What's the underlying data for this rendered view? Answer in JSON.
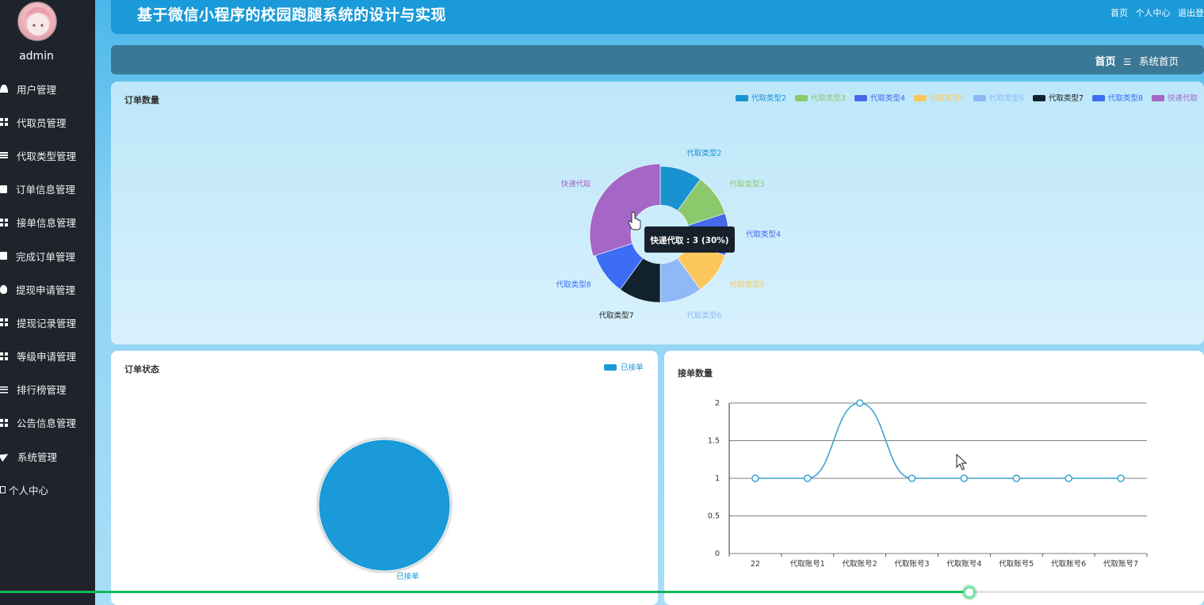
{
  "sidebar": {
    "username": "admin",
    "items": [
      {
        "label": "用户管理",
        "icon": "user-icon"
      },
      {
        "label": "代取员管理",
        "icon": "grid-icon"
      },
      {
        "label": "代取类型管理",
        "icon": "list-icon"
      },
      {
        "label": "订单信息管理",
        "icon": "clipboard-icon"
      },
      {
        "label": "接单信息管理",
        "icon": "grid-icon"
      },
      {
        "label": "完成订单管理",
        "icon": "checkbox-icon"
      },
      {
        "label": "提现申请管理",
        "icon": "bulb-icon"
      },
      {
        "label": "提现记录管理",
        "icon": "grid-icon"
      },
      {
        "label": "等级申请管理",
        "icon": "grid-icon"
      },
      {
        "label": "排行榜管理",
        "icon": "sliders-icon"
      },
      {
        "label": "公告信息管理",
        "icon": "grid-icon"
      },
      {
        "label": "系统管理",
        "icon": "send-icon"
      },
      {
        "label": "个人中心",
        "icon": "box-icon"
      }
    ]
  },
  "header": {
    "title": "基于微信小程序的校园跑腿系统的设计与实现",
    "links": [
      "首页",
      "个人中心",
      "退出登"
    ]
  },
  "breadcrumb": {
    "home": "首页",
    "separator": "☰",
    "current": "系统首页"
  },
  "panels": {
    "orders": {
      "title": "订单数量"
    },
    "status": {
      "title": "订单状态"
    },
    "accept": {
      "title": "接单数量"
    }
  },
  "tooltip": "快递代取 : 3 (30%)",
  "video": {
    "progress": 0.805
  },
  "chart_data": [
    {
      "type": "pie",
      "variant": "donut",
      "title": "订单数量",
      "legend_position": "top-right",
      "categories": [
        "代取类型2",
        "代取类型3",
        "代取类型4",
        "代取类型5",
        "代取类型6",
        "代取类型7",
        "代取类型8",
        "快递代取"
      ],
      "values": [
        1,
        1,
        1,
        1,
        1,
        1,
        1,
        3
      ],
      "colors": [
        "#1a92d2",
        "#8cc96c",
        "#4669ea",
        "#fbc75c",
        "#8fb8f6",
        "#11222f",
        "#3d6cf5",
        "#a467c7"
      ]
    },
    {
      "type": "pie",
      "title": "订单状态",
      "legend_position": "top-right",
      "categories": [
        "已接单"
      ],
      "values": [
        1
      ],
      "colors": [
        "#1a9ad8"
      ]
    },
    {
      "type": "line",
      "smooth": true,
      "title": "接单数量",
      "x": [
        "22",
        "代取账号1",
        "代取账号2",
        "代取账号3",
        "代取账号4",
        "代取账号5",
        "代取账号6",
        "代取账号7"
      ],
      "series": [
        {
          "values": [
            1,
            1,
            2,
            1,
            1,
            1,
            1,
            1
          ]
        }
      ],
      "ylim": [
        0,
        2
      ],
      "yticks": [
        "0",
        "0.5",
        "1",
        "1.5",
        "2"
      ],
      "grid": true,
      "color": "#3aa3d3"
    }
  ]
}
